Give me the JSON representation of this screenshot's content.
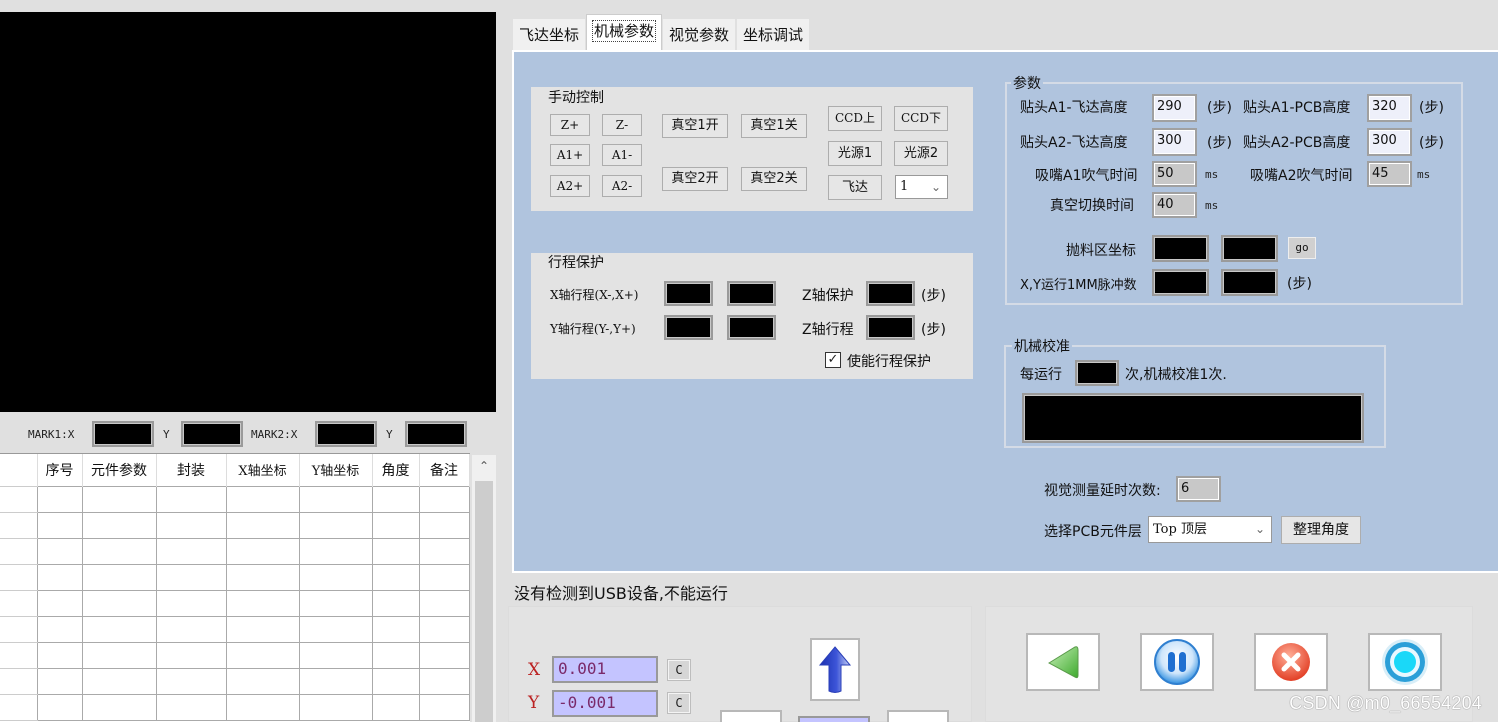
{
  "video": {
    "label": "camera-view"
  },
  "marks": {
    "mark1_x_label": "MARK1:X",
    "mark1_y_label": "Y",
    "mark2_x_label": "MARK2:X",
    "mark2_y_label": "Y"
  },
  "table": {
    "columns": [
      "",
      "序号",
      "元件参数",
      "封装",
      "X轴坐标",
      "Y轴坐标",
      "角度",
      "备注"
    ],
    "row_count": 9
  },
  "tabs": [
    {
      "label": "飞达坐标",
      "active": false
    },
    {
      "label": "机械参数",
      "active": true
    },
    {
      "label": "视觉参数",
      "active": false
    },
    {
      "label": "坐标调试",
      "active": false
    }
  ],
  "manual": {
    "title": "手动控制",
    "z_plus": "Z+",
    "z_minus": "Z-",
    "a1_plus": "A1+",
    "a1_minus": "A1-",
    "a2_plus": "A2+",
    "a2_minus": "A2-",
    "vac1_on": "真空1开",
    "vac1_off": "真空1关",
    "vac2_on": "真空2开",
    "vac2_off": "真空2关",
    "ccd_up": "CCD上",
    "ccd_down": "CCD下",
    "light1": "光源1",
    "light2": "光源2",
    "feeder": "飞达",
    "feeder_select": "1"
  },
  "travel": {
    "title": "行程保护",
    "x_label": "X轴行程(X-,X+)",
    "y_label": "Y轴行程(Y-,Y+)",
    "z_protect_label": "Z轴保护",
    "z_travel_label": "Z轴行程",
    "unit": "(步)",
    "enable_label": "使能行程保护",
    "enable_checked": true
  },
  "params": {
    "title": "参数",
    "a1_feeder_height_label": "贴头A1-飞达高度",
    "a1_feeder_height": "290",
    "a1_pcb_height_label": "贴头A1-PCB高度",
    "a1_pcb_height": "320",
    "a2_feeder_height_label": "贴头A2-飞达高度",
    "a2_feeder_height": "300",
    "a2_pcb_height_label": "贴头A2-PCB高度",
    "a2_pcb_height": "300",
    "step_unit": "(步)",
    "nozzle_a1_blow_label": "吸嘴A1吹气时间",
    "nozzle_a1_blow": "50",
    "nozzle_a2_blow_label": "吸嘴A2吹气时间",
    "nozzle_a2_blow": "45",
    "vac_switch_label": "真空切换时间",
    "vac_switch": "40",
    "ms_unit": "ms",
    "discard_label": "抛料区坐标",
    "go_label": "go",
    "pulse_label": "X,Y运行1MM脉冲数"
  },
  "calibration": {
    "title": "机械校准",
    "prefix": "每运行",
    "suffix": "次,机械校准1次."
  },
  "vision": {
    "delay_label": "视觉测量延时次数:",
    "delay_value": "6",
    "layer_label": "选择PCB元件层",
    "layer_value": "Top 顶层",
    "arrange_label": "整理角度"
  },
  "status": {
    "message": "没有检测到USB设备,不能运行"
  },
  "jog": {
    "x_label": "X",
    "x_value": "0.001",
    "y_label": "Y",
    "y_value": "-0.001",
    "clear_label": "C"
  },
  "controls": {
    "back": "back-icon",
    "pause": "pause-icon",
    "stop": "stop-icon",
    "start": "start-icon"
  },
  "watermark": "CSDN @m0_66554204",
  "colors": {
    "panel_blue": "#b0c4de",
    "group_gray": "#e3e3e3",
    "coord_input": "#c4c4ff",
    "axis_label_red": "#b22222"
  }
}
